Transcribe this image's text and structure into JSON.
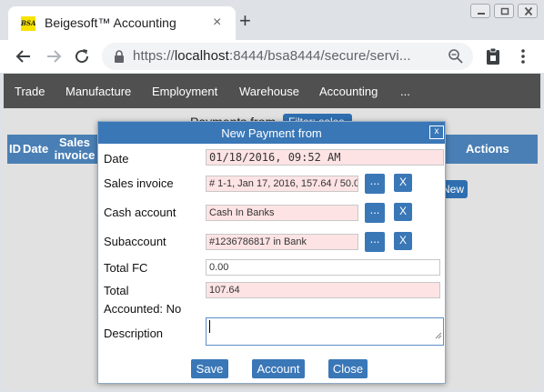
{
  "browser": {
    "tab_title": "Beigesoft™ Accounting",
    "tab_favicon_text": "BSA",
    "tab_close": "×",
    "new_tab": "+",
    "url_scheme": "https://",
    "url_host": "localhost",
    "url_rest": ":8444/bsa8444/secure/servi..."
  },
  "appnav": {
    "items": [
      "Trade",
      "Manufacture",
      "Employment",
      "Warehouse",
      "Accounting",
      "..."
    ]
  },
  "background": {
    "title": "Payments from",
    "filter_button": "Filter: sales",
    "columns": [
      "ID",
      "Date",
      "Sales invoice",
      "Actions"
    ],
    "new_button": "New"
  },
  "dialog": {
    "title": "New Payment from",
    "close": "x",
    "date_label": "Date",
    "date_value": "01/18/2016, 09:52 AM",
    "sales_invoice_label": "Sales invoice",
    "sales_invoice_value": "# 1-1, Jan 17, 2016, 157.64 / 50.0",
    "cash_account_label": "Cash account",
    "cash_account_value": "Cash In Banks",
    "subaccount_label": "Subaccount",
    "subaccount_value": "#1236786817 in Bank",
    "total_fc_label": "Total FC",
    "total_fc_value": "0.00",
    "total_label": "Total",
    "total_value": "107.64",
    "accounted_label": "Accounted: No",
    "description_label": "Description",
    "description_value": "",
    "picker_label": "...",
    "clear_label": "X",
    "save_button": "Save",
    "account_button": "Account",
    "close_button": "Close"
  },
  "colors": {
    "accent": "#3a77b7",
    "appnav_bg": "#505050",
    "required_field_bg": "#fde3e4"
  }
}
